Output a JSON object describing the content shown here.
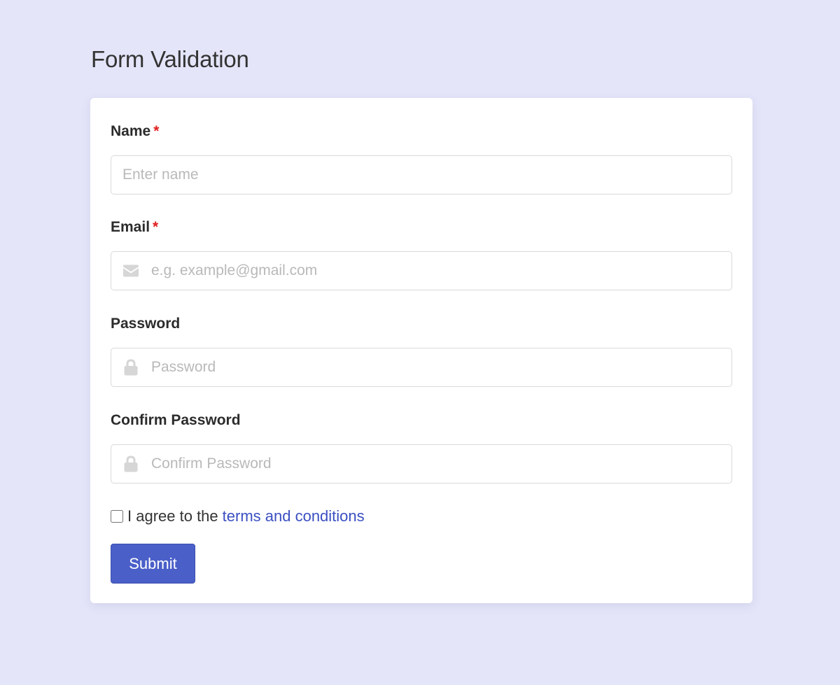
{
  "page": {
    "title": "Form Validation"
  },
  "form": {
    "name": {
      "label": "Name",
      "required_mark": "*",
      "placeholder": "Enter name",
      "value": ""
    },
    "email": {
      "label": "Email",
      "required_mark": "*",
      "placeholder": "e.g. example@gmail.com",
      "value": "",
      "icon": "envelope-icon"
    },
    "password": {
      "label": "Password",
      "placeholder": "Password",
      "value": "",
      "icon": "lock-icon"
    },
    "confirm_password": {
      "label": "Confirm Password",
      "placeholder": "Confirm Password",
      "value": "",
      "icon": "lock-icon"
    },
    "agree": {
      "prefix": "I agree to the",
      "link_text": "terms and conditions",
      "checked": false
    },
    "submit_label": "Submit"
  },
  "colors": {
    "background": "#e4e5f9",
    "card": "#ffffff",
    "accent": "#4a5fc8",
    "link": "#3a4fc2",
    "required": "#e02020",
    "icon": "#d6d6d6"
  }
}
